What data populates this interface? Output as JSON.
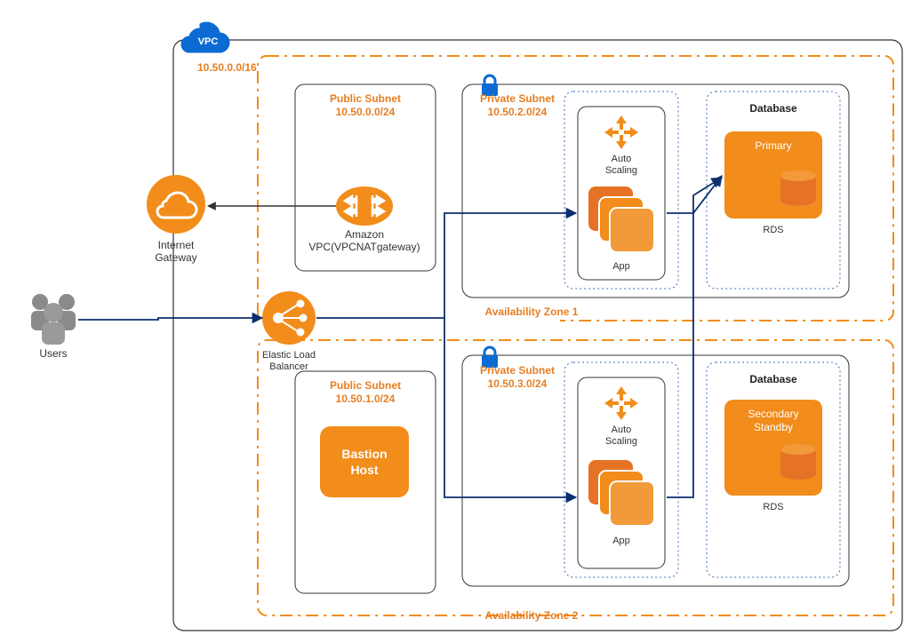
{
  "vpc": {
    "badge": "VPC",
    "cidr": "10.50.0.0/16"
  },
  "users": {
    "label": "Users"
  },
  "igw": {
    "label1": "Internet",
    "label2": "Gateway"
  },
  "elb": {
    "label1": "Elastic Load",
    "label2": "Balancer"
  },
  "nat": {
    "label1": "Amazon",
    "label2": "VPC(VPCNATgateway)"
  },
  "az1": {
    "label": "Availability Zone 1",
    "publicSubnet": {
      "title": "Public Subnet",
      "cidr": "10.50.0.0/24"
    },
    "privateSubnet": {
      "title": "Private Subnet",
      "cidr": "10.50.2.0/24"
    },
    "autoScaling": {
      "label1": "Auto",
      "label2": "Scaling",
      "appLabel": "App"
    },
    "database": {
      "groupLabel": "Database",
      "boxLabel": "Primary",
      "rdsLabel": "RDS"
    }
  },
  "az2": {
    "label": "Availability Zone 2",
    "publicSubnet": {
      "title": "Public Subnet",
      "cidr": "10.50.1.0/24",
      "bastion1": "Bastion",
      "bastion2": "Host"
    },
    "privateSubnet": {
      "title": "Private Subnet",
      "cidr": "10.50.3.0/24"
    },
    "autoScaling": {
      "label1": "Auto",
      "label2": "Scaling",
      "appLabel": "App"
    },
    "database": {
      "groupLabel": "Database",
      "boxLabel1": "Secondary",
      "boxLabel2": "Standby",
      "rdsLabel": "RDS"
    }
  }
}
